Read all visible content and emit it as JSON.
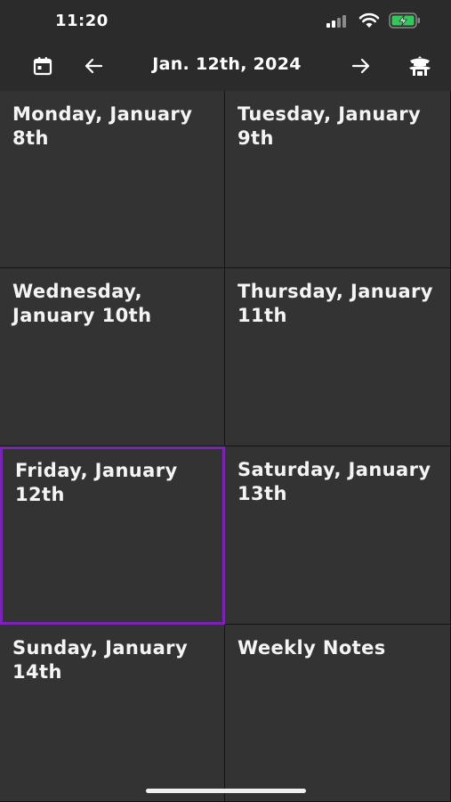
{
  "status_bar": {
    "time": "11:20"
  },
  "toolbar": {
    "title": "Jan. 12th, 2024",
    "calendar_icon": "calendar-icon",
    "prev_icon": "arrow-left-icon",
    "next_icon": "arrow-right-icon",
    "temple_icon": "temple-icon"
  },
  "days": [
    {
      "label": "Monday, January 8th",
      "selected": false
    },
    {
      "label": "Tuesday, January 9th",
      "selected": false
    },
    {
      "label": "Wednesday, January 10th",
      "selected": false
    },
    {
      "label": "Thursday, January 11th",
      "selected": false
    },
    {
      "label": "Friday, January 12th",
      "selected": true
    },
    {
      "label": "Saturday, January 13th",
      "selected": false
    },
    {
      "label": "Sunday, January 14th",
      "selected": false
    }
  ],
  "weekly_notes": {
    "label": "Weekly Notes"
  },
  "colors": {
    "background": "#333333",
    "selected_border": "#7b22b8",
    "battery_charging": "#34c759"
  }
}
